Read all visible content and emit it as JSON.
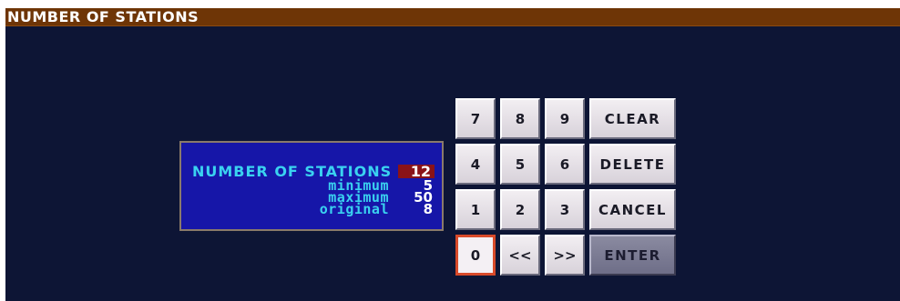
{
  "window": {
    "title": "NUMBER OF STATIONS"
  },
  "info_panel": {
    "label": "NUMBER OF STATIONS",
    "current_value": "12",
    "minimum_label": "minimum",
    "minimum_value": "5",
    "maximum_label": "maximum",
    "maximum_value": "50",
    "original_label": "original",
    "original_value": "8"
  },
  "keypad": {
    "k7": "7",
    "k8": "8",
    "k9": "9",
    "k4": "4",
    "k5": "5",
    "k6": "6",
    "k1": "1",
    "k2": "2",
    "k3": "3",
    "k0": "0",
    "left": "<<",
    "right": ">>",
    "clear": "CLEAR",
    "delete": "DELETE",
    "cancel": "CANCEL",
    "enter": "ENTER"
  },
  "colors": {
    "background": "#0d1535",
    "title_bar": "#6e3506",
    "panel": "#1616a8",
    "label_text": "#3ad2f0",
    "current_value_bg": "#8a1318",
    "selected_key_border": "#d84a2a"
  }
}
